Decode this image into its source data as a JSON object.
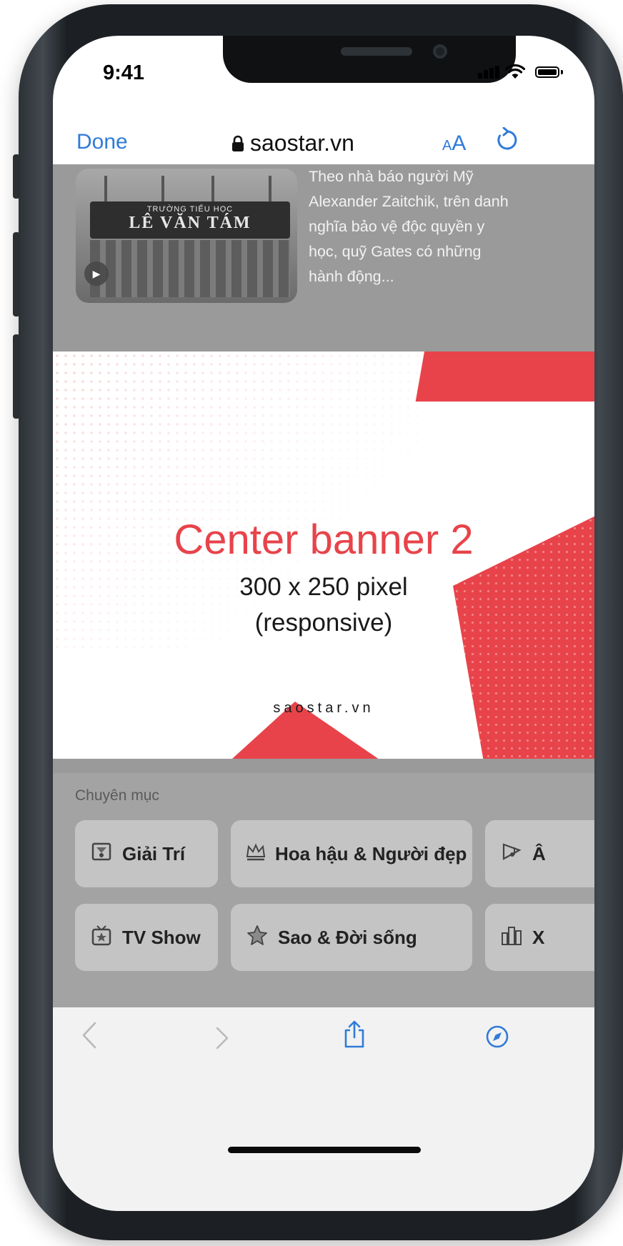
{
  "status_bar": {
    "time": "9:41"
  },
  "browser": {
    "done_label": "Done",
    "url": "saostar.vn",
    "text_size_small": "A",
    "text_size_big": "A"
  },
  "article": {
    "thumbnail_sign_small": "TRƯỜNG TIỂU HỌC",
    "thumbnail_sign_big": "LÊ VĂN TÁM",
    "excerpt": "Theo nhà báo người Mỹ Alexander Zaitchik, trên danh nghĩa bảo vệ độc quyền y học, quỹ Gates có những hành động..."
  },
  "banner": {
    "title": "Center banner 2",
    "size": "300 x 250 pixel",
    "note": "(responsive)",
    "site": "saostar.vn",
    "accent_color": "#e8434a"
  },
  "categories": {
    "heading": "Chuyên mục",
    "items": [
      {
        "label": "Giải Trí",
        "icon": "entertainment-icon"
      },
      {
        "label": "Hoa hậu & Người đẹp",
        "icon": "crown-icon"
      },
      {
        "label": "Â",
        "icon": "music-icon"
      },
      {
        "label": "TV Show",
        "icon": "tv-icon"
      },
      {
        "label": "Sao & Đời sống",
        "icon": "star-icon"
      },
      {
        "label": "X",
        "icon": "city-icon"
      }
    ]
  },
  "toolbar": {
    "back_icon": "chevron-left-icon",
    "forward_icon": "chevron-right-icon",
    "share_icon": "share-icon",
    "compass_icon": "compass-icon"
  },
  "colors": {
    "link_blue": "#2f7bd9",
    "dim_overlay": "#9a9a9a"
  }
}
